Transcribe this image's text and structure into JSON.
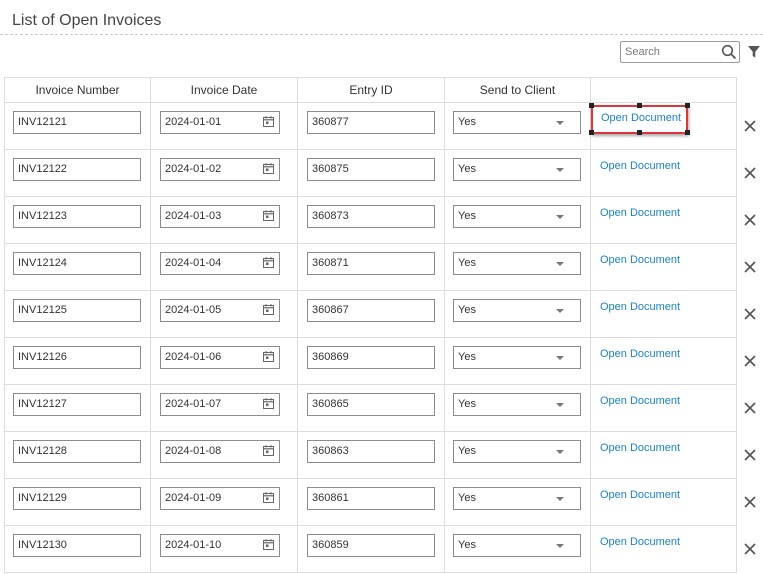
{
  "page": {
    "title": "List of Open Invoices"
  },
  "search": {
    "placeholder": "Search",
    "value": ""
  },
  "icons": {
    "search": "search-icon",
    "filter": "filter-icon",
    "calendar": "calendar-icon",
    "dropdown": "chevron-down-icon",
    "delete": "close-icon"
  },
  "colors": {
    "link": "#1a82c8",
    "selection": "#d9363e"
  },
  "table": {
    "headers": [
      "Invoice Number",
      "Invoice Date",
      "Entry ID",
      "Send to Client",
      ""
    ],
    "link_label": "Open Document",
    "rows": [
      {
        "invoice": "INV12121",
        "date": "2024-01-01",
        "entry": "360877",
        "send": "Yes"
      },
      {
        "invoice": "INV12122",
        "date": "2024-01-02",
        "entry": "360875",
        "send": "Yes"
      },
      {
        "invoice": "INV12123",
        "date": "2024-01-03",
        "entry": "360873",
        "send": "Yes"
      },
      {
        "invoice": "INV12124",
        "date": "2024-01-04",
        "entry": "360871",
        "send": "Yes"
      },
      {
        "invoice": "INV12125",
        "date": "2024-01-05",
        "entry": "360867",
        "send": "Yes"
      },
      {
        "invoice": "INV12126",
        "date": "2024-01-06",
        "entry": "360869",
        "send": "Yes"
      },
      {
        "invoice": "INV12127",
        "date": "2024-01-07",
        "entry": "360865",
        "send": "Yes"
      },
      {
        "invoice": "INV12128",
        "date": "2024-01-08",
        "entry": "360863",
        "send": "Yes"
      },
      {
        "invoice": "INV12129",
        "date": "2024-01-09",
        "entry": "360861",
        "send": "Yes"
      },
      {
        "invoice": "INV12130",
        "date": "2024-01-10",
        "entry": "360859",
        "send": "Yes"
      }
    ]
  }
}
